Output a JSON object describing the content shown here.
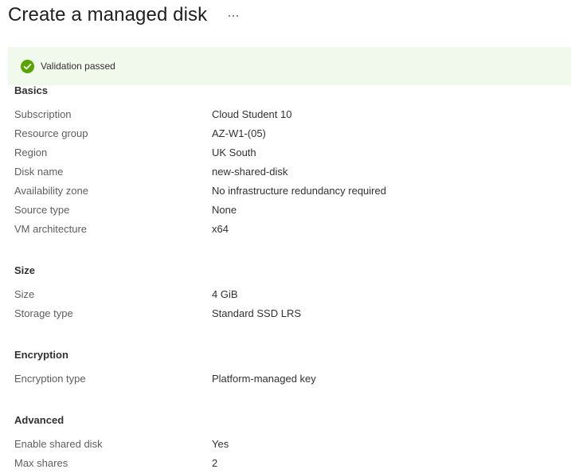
{
  "header": {
    "title": "Create a managed disk",
    "more_label": "..."
  },
  "banner": {
    "text": "Validation passed",
    "status_color": "#57a300"
  },
  "sections": {
    "basics": {
      "title": "Basics",
      "rows": [
        {
          "label": "Subscription",
          "value": "Cloud Student 10"
        },
        {
          "label": "Resource group",
          "value": "AZ-W1-(05)"
        },
        {
          "label": "Region",
          "value": "UK South"
        },
        {
          "label": "Disk name",
          "value": "new-shared-disk"
        },
        {
          "label": "Availability zone",
          "value": "No infrastructure redundancy required"
        },
        {
          "label": "Source type",
          "value": "None"
        },
        {
          "label": "VM architecture",
          "value": "x64"
        }
      ]
    },
    "size": {
      "title": "Size",
      "rows": [
        {
          "label": "Size",
          "value": "4 GiB"
        },
        {
          "label": "Storage type",
          "value": "Standard SSD LRS"
        }
      ]
    },
    "encryption": {
      "title": "Encryption",
      "rows": [
        {
          "label": "Encryption type",
          "value": "Platform-managed key"
        }
      ]
    },
    "advanced": {
      "title": "Advanced",
      "rows": [
        {
          "label": "Enable shared disk",
          "value": "Yes"
        },
        {
          "label": "Max shares",
          "value": "2"
        }
      ]
    }
  }
}
